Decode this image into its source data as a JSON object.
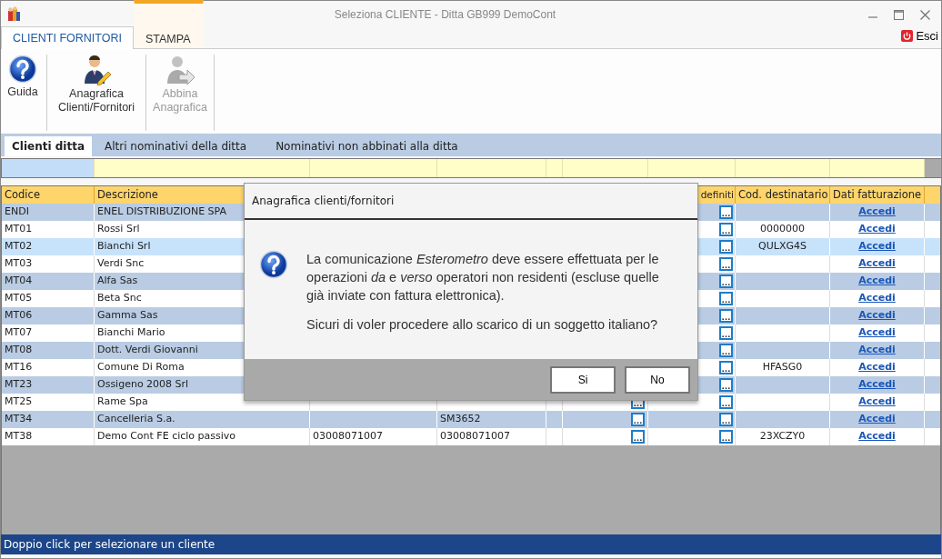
{
  "window": {
    "title": "Seleziona CLIENTE  - Ditta GB999 DemoCont"
  },
  "ribbon_tabs": [
    {
      "label": "CLIENTI FORNITORI",
      "selected": true,
      "contextual": false
    },
    {
      "label": "STAMPA",
      "selected": false,
      "contextual": true
    }
  ],
  "exit_button": {
    "label": "Esci"
  },
  "toolbar": [
    {
      "kind": "help",
      "label": "Guida",
      "disabled": false
    },
    {
      "kind": "person",
      "label": "Anagrafica Clienti/Fornitori",
      "disabled": false
    },
    {
      "kind": "link",
      "label": "Abbina Anagrafica",
      "disabled": true
    }
  ],
  "sub_tabs": [
    {
      "label": "Clienti ditta",
      "selected": true
    },
    {
      "label": "Altri nominativi della ditta",
      "selected": false
    },
    {
      "label": "Nominativi non abbinati alla ditta",
      "selected": false
    }
  ],
  "table": {
    "columns": [
      "Codice",
      "Descrizione",
      "",
      "",
      "",
      "",
      "definiti",
      "Cod. destinatario",
      "Dati fatturazione"
    ],
    "rows": [
      {
        "codice": "ENDI",
        "descrizione": "ENEL DISTRIBUZIONE SPA",
        "cod_destinatario": "",
        "link": "Accedi",
        "selected": false
      },
      {
        "codice": "MT01",
        "descrizione": "Rossi Srl",
        "cod_destinatario": "0000000",
        "link": "Accedi",
        "selected": false
      },
      {
        "codice": "MT02",
        "descrizione": "Bianchi Srl",
        "cod_destinatario": "QULXG4S",
        "link": "Accedi",
        "selected": true
      },
      {
        "codice": "MT03",
        "descrizione": "Verdi Snc",
        "cod_destinatario": "",
        "link": "Accedi",
        "selected": false
      },
      {
        "codice": "MT04",
        "descrizione": "Alfa Sas",
        "cod_destinatario": "",
        "link": "Accedi",
        "selected": false
      },
      {
        "codice": "MT05",
        "descrizione": "Beta Snc",
        "cod_destinatario": "",
        "link": "Accedi",
        "selected": false
      },
      {
        "codice": "MT06",
        "descrizione": "Gamma Sas",
        "cod_destinatario": "",
        "link": "Accedi",
        "selected": false
      },
      {
        "codice": "MT07",
        "descrizione": "Bianchi Mario",
        "cod_destinatario": "",
        "link": "Accedi",
        "selected": false
      },
      {
        "codice": "MT08",
        "descrizione": "Dott. Verdi Giovanni",
        "cod_destinatario": "",
        "link": "Accedi",
        "selected": false
      },
      {
        "codice": "MT16",
        "descrizione": "Comune Di Roma",
        "cod_destinatario": "HFASG0",
        "link": "Accedi",
        "selected": false
      },
      {
        "codice": "MT23",
        "descrizione": "Ossigeno 2008 Srl",
        "cod_destinatario": "",
        "link": "Accedi",
        "selected": false
      },
      {
        "codice": "MT25",
        "descrizione": "Rame Spa",
        "cod_destinatario": "",
        "link": "Accedi",
        "selected": false,
        "extra_button": true
      },
      {
        "codice": "MT34",
        "descrizione": "Cancelleria S.a.",
        "column_3": "",
        "column_4": "SM3652",
        "cod_destinatario": "",
        "link": "Accedi",
        "selected": false,
        "extra_button": true
      },
      {
        "codice": "MT38",
        "descrizione": "Demo Cont FE ciclo passivo",
        "column_3": "03008071007",
        "column_4": "03008071007",
        "cod_destinatario": "23XCZY0",
        "link": "Accedi",
        "selected": false,
        "extra_button": true
      }
    ]
  },
  "dialog": {
    "title": "Anagrafica clienti/fornitori",
    "message": "La comunicazione *Esterometro* deve essere effettuata per le operazioni *da* e *verso* operatori non residenti (escluse quelle già inviate con fattura elettronica).",
    "question": "Sicuri di voler procedere allo scarico di un soggetto italiano?",
    "buttons": [
      "Si",
      "No"
    ]
  },
  "status_bar": "Doppio click per selezionare un cliente"
}
